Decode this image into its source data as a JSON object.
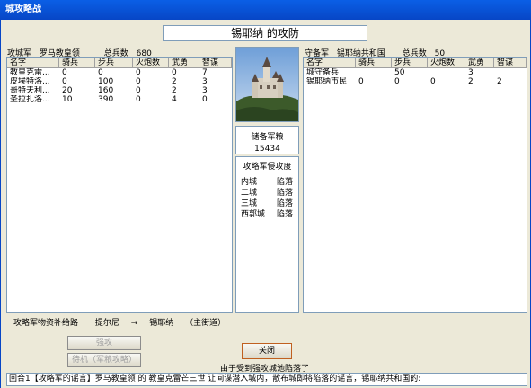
{
  "window": {
    "title": "城攻略战"
  },
  "battle": {
    "title": "锡耶纳 的攻防"
  },
  "attacker": {
    "side_label": "攻城军",
    "name": "罗马教皇领",
    "total_label": "总兵数",
    "total": "680",
    "columns": [
      "名字",
      "骑兵",
      "步兵",
      "火炮数",
      "武勇",
      "智谋"
    ],
    "rows": [
      [
        "教皇克雷...",
        "0",
        "0",
        "0",
        "0",
        "7"
      ],
      [
        "皮埃特洛...",
        "0",
        "100",
        "0",
        "2",
        "3"
      ],
      [
        "哥特夫利...",
        "20",
        "160",
        "0",
        "2",
        "3"
      ],
      [
        "圣拉扎洛...",
        "10",
        "390",
        "0",
        "4",
        "0"
      ]
    ]
  },
  "defender": {
    "side_label": "守备军",
    "name": "锡耶纳共和国",
    "total_label": "总兵数",
    "total": "50",
    "columns": [
      "名字",
      "骑兵",
      "步兵",
      "火炮数",
      "武勇",
      "智谋"
    ],
    "rows": [
      [
        "城守备兵",
        "",
        "50",
        "",
        "3",
        ""
      ],
      [
        "锡耶纳市民",
        "0",
        "0",
        "0",
        "2",
        "2"
      ]
    ]
  },
  "reserve": {
    "label": "储备军粮",
    "value": "15434"
  },
  "conquest": {
    "label": "攻略军侵攻度",
    "items": [
      {
        "name": "内城",
        "status": "陷落"
      },
      {
        "name": "二城",
        "status": "陷落"
      },
      {
        "name": "三城",
        "status": "陷落"
      },
      {
        "name": "西郭城",
        "status": "陷落"
      }
    ]
  },
  "supply": {
    "label": "攻略军物资补给路",
    "from": "提尔尼",
    "arrow": "→",
    "to": "锡耶纳",
    "note": "（主街道）"
  },
  "buttons": {
    "force_attack": "强攻",
    "wait": "待机（军粮攻略）",
    "close": "关闭"
  },
  "status_text": "由于受到强攻城池陷落了",
  "log": "回合1【攻略军的谣言】罗马教皇领 的 教皇克雷芒三世 让间谍潜入城内，散布城即将陷落的谣言，锡耶纳共和国的:"
}
